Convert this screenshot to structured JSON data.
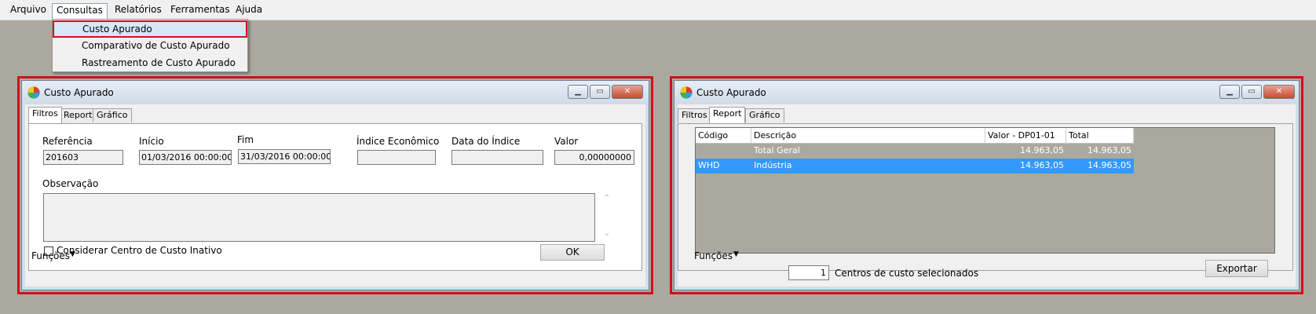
{
  "menubar": {
    "items": [
      "Arquivo",
      "Consultas",
      "Relatórios",
      "Ferramentas",
      "Ajuda"
    ],
    "open_menu": {
      "items": [
        "Custo Apurado",
        "Comparativo de Custo Apurado",
        "Rastreamento de Custo Apurado"
      ]
    }
  },
  "win_left": {
    "title": "Custo Apurado",
    "tabs": [
      "Filtros",
      "Report",
      "Gráfico"
    ],
    "active_tab": "Filtros",
    "fields": {
      "referencia_label": "Referência",
      "referencia_value": "201603",
      "inicio_label": "Início",
      "inicio_value": "01/03/2016 00:00:00",
      "fim_label": "Fim",
      "fim_value": "31/03/2016 00:00:00",
      "indice_label": "Índice Econômico",
      "indice_value": "",
      "data_indice_label": "Data do Índice",
      "data_indice_value": "",
      "valor_label": "Valor",
      "valor_value": "0,00000000"
    },
    "observacao_label": "Observação",
    "observacao_value": "",
    "checkbox_label": "Considerar Centro de Custo Inativo",
    "checkbox_checked": false,
    "funcoes_label": "Funções",
    "ok_label": "OK"
  },
  "win_right": {
    "title": "Custo Apurado",
    "tabs": [
      "Filtros",
      "Report",
      "Gráfico"
    ],
    "active_tab": "Report",
    "grid": {
      "columns": [
        "Código",
        "Descrição",
        "Valor - DP01-01",
        "Total"
      ],
      "rows": [
        {
          "codigo": "",
          "descricao": "Total Geral",
          "valor": "14.963,05",
          "total": "14.963,05",
          "style": "total"
        },
        {
          "codigo": "WHD",
          "descricao": "Indústria",
          "valor": "14.963,05",
          "total": "14.963,05",
          "style": "selected"
        }
      ]
    },
    "funcoes_label": "Funções",
    "count_value": "1",
    "count_label": "Centros de custo selecionados",
    "exportar_label": "Exportar"
  },
  "colors": {
    "highlight_frame": "#d0101e",
    "selection": "#3399ff",
    "desktop": "#aba99f"
  }
}
